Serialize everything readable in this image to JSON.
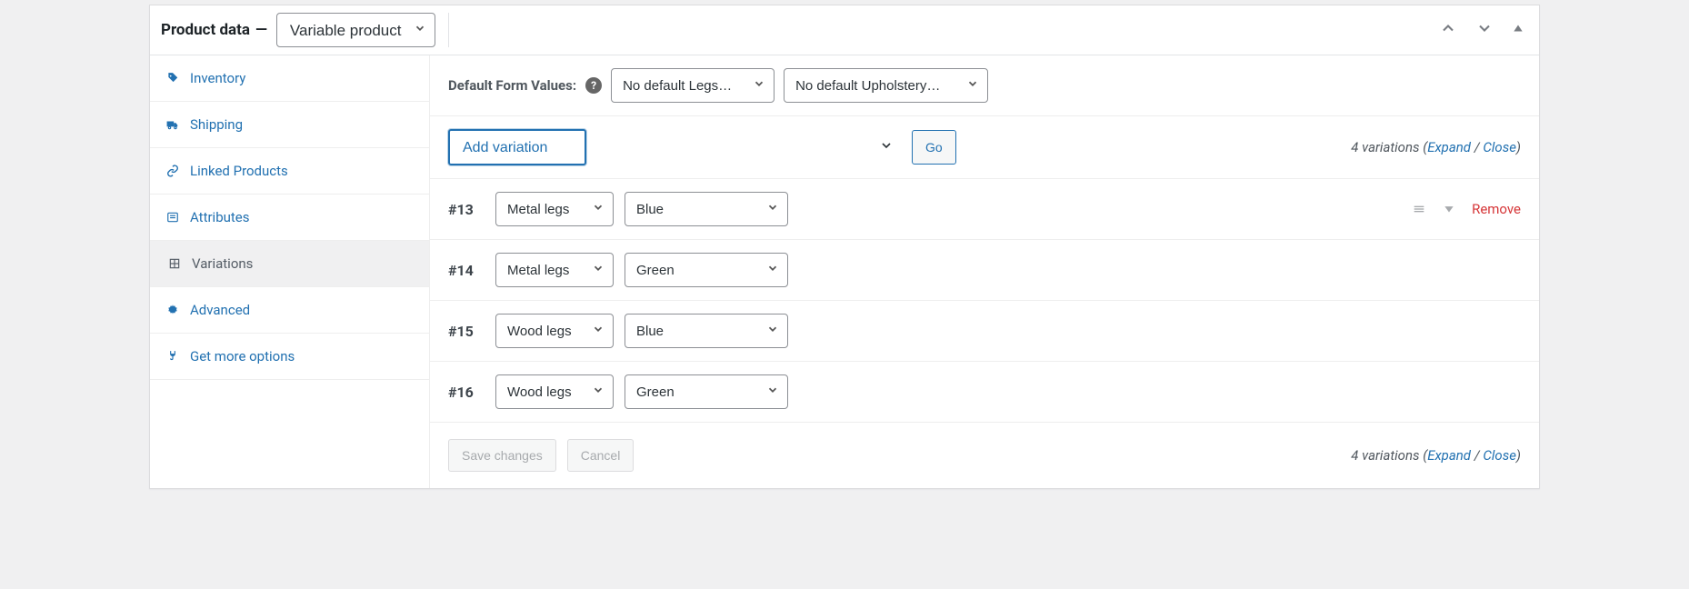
{
  "header": {
    "title": "Product data",
    "product_type": "Variable product"
  },
  "tabs": [
    {
      "icon": "tag-icon",
      "label": "Inventory",
      "active": false
    },
    {
      "icon": "truck-icon",
      "label": "Shipping",
      "active": false
    },
    {
      "icon": "link-icon",
      "label": "Linked Products",
      "active": false
    },
    {
      "icon": "list-icon",
      "label": "Attributes",
      "active": false
    },
    {
      "icon": "grid-icon",
      "label": "Variations",
      "active": true
    },
    {
      "icon": "gear-icon",
      "label": "Advanced",
      "active": false
    },
    {
      "icon": "plug-icon",
      "label": "Get more options",
      "active": false
    }
  ],
  "defaults": {
    "label": "Default Form Values:",
    "legs_placeholder": "No default Legs…",
    "upholstery_placeholder": "No default Upholstery…"
  },
  "actions": {
    "add_variation": "Add variation",
    "go": "Go",
    "save": "Save changes",
    "cancel": "Cancel",
    "expand": "Expand",
    "close": "Close",
    "remove": "Remove"
  },
  "meta": {
    "count_text": "4 variations"
  },
  "legs_options": [
    "Metal legs",
    "Wood legs"
  ],
  "upholstery_options": [
    "Blue",
    "Green"
  ],
  "variations": [
    {
      "id": "#13",
      "legs": "Metal legs",
      "upholstery": "Blue",
      "hover": true
    },
    {
      "id": "#14",
      "legs": "Metal legs",
      "upholstery": "Green",
      "hover": false
    },
    {
      "id": "#15",
      "legs": "Wood legs",
      "upholstery": "Blue",
      "hover": false
    },
    {
      "id": "#16",
      "legs": "Wood legs",
      "upholstery": "Green",
      "hover": false
    }
  ]
}
